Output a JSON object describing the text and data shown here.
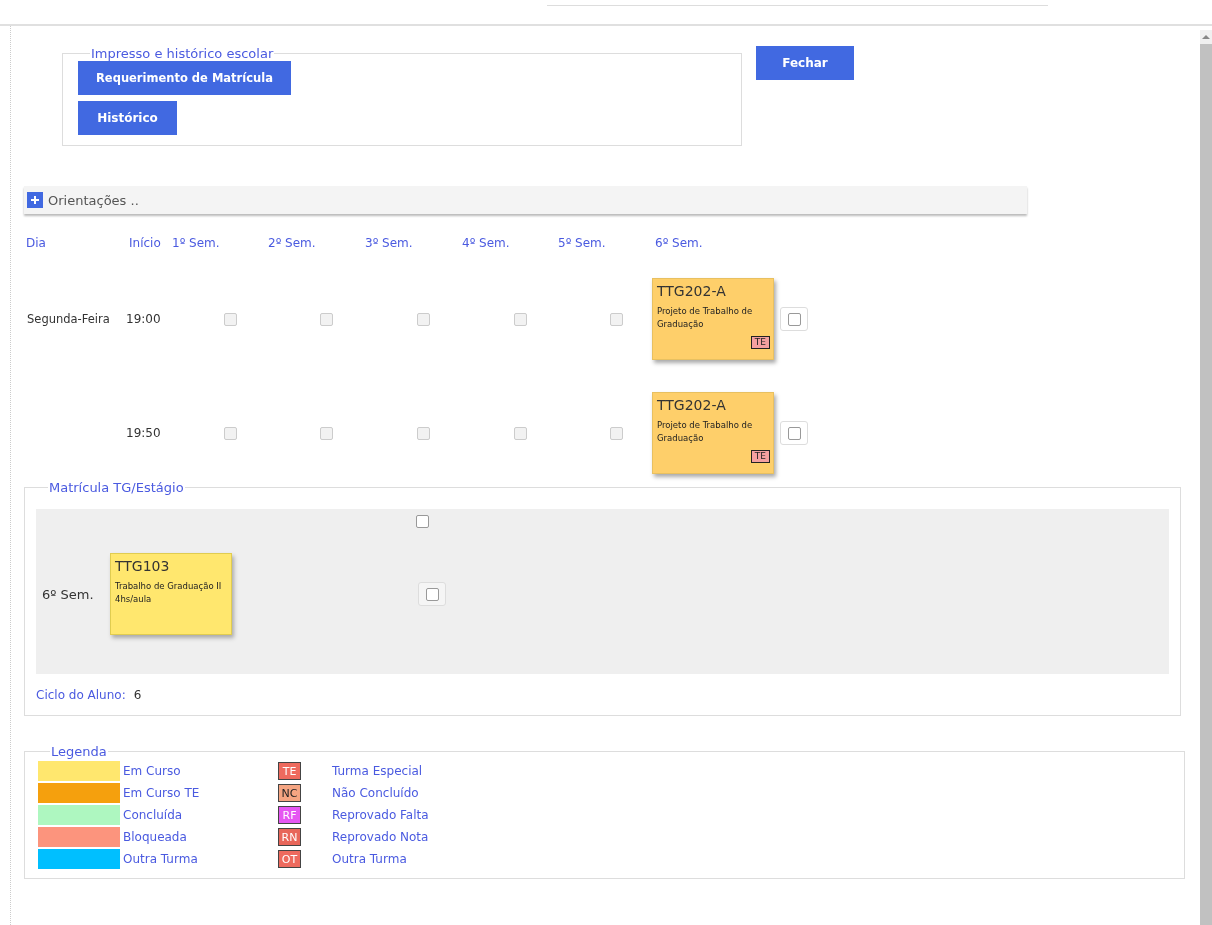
{
  "print_section": {
    "title": "Impresso e histórico escolar",
    "buttons": [
      "Requerimento de Matrícula",
      "Histórico"
    ]
  },
  "close_button": "Fechar",
  "orientations": {
    "label": "Orientações ..",
    "expanded": false
  },
  "schedule": {
    "columns": [
      "Dia",
      "Início",
      "1º Sem.",
      "2º Sem.",
      "3º Sem.",
      "4º Sem.",
      "5º Sem.",
      "6º Sem."
    ],
    "rows": [
      {
        "day": "Segunda-Feira",
        "start": "19:00",
        "slots": [
          {
            "kind": "empty",
            "checked": false
          },
          {
            "kind": "empty",
            "checked": false
          },
          {
            "kind": "empty",
            "checked": false
          },
          {
            "kind": "empty",
            "checked": false
          },
          {
            "kind": "empty",
            "checked": false
          },
          {
            "kind": "course",
            "code": "TTG202-A",
            "name": "Projeto de Trabalho de Graduação",
            "tag": "TE",
            "color": "#fecf6a",
            "checked": false
          }
        ]
      },
      {
        "day": "",
        "start": "19:50",
        "slots": [
          {
            "kind": "empty",
            "checked": false
          },
          {
            "kind": "empty",
            "checked": false
          },
          {
            "kind": "empty",
            "checked": false
          },
          {
            "kind": "empty",
            "checked": false
          },
          {
            "kind": "empty",
            "checked": false
          },
          {
            "kind": "course",
            "code": "TTG202-A",
            "name": "Projeto de Trabalho de Graduação",
            "tag": "TE",
            "color": "#fecf6a",
            "checked": false
          }
        ]
      }
    ]
  },
  "tg_section": {
    "title": "Matrícula TG/Estágio",
    "header_checked": false,
    "rows": [
      {
        "semester": "6º Sem.",
        "code": "TTG103",
        "name": "Trabalho de Graduação II",
        "hours": "4hs/aula",
        "color": "#ffe76e",
        "checked": false
      }
    ],
    "cycle_label": "Ciclo do Aluno:",
    "cycle_value": "6"
  },
  "legend": {
    "title": "Legenda",
    "statuses": [
      {
        "label": "Em Curso",
        "color": "#ffe76e"
      },
      {
        "label": "Em Curso TE",
        "color": "#f5a00d"
      },
      {
        "label": "Concluída",
        "color": "#aef7c0"
      },
      {
        "label": "Bloqueada",
        "color": "#fc947d"
      },
      {
        "label": "Outra Turma",
        "color": "#00bfff"
      }
    ],
    "badges": [
      {
        "code": "TE",
        "label": "Turma Especial",
        "color": "#ee6a5e"
      },
      {
        "code": "NC",
        "label": "Não Concluído",
        "color": "#f5a582"
      },
      {
        "code": "RF",
        "label": "Reprovado Falta",
        "color": "#e656f2"
      },
      {
        "code": "RN",
        "label": "Reprovado Nota",
        "color": "#e8665a"
      },
      {
        "code": "OT",
        "label": "Outra Turma",
        "color": "#ee6a5e"
      }
    ]
  }
}
